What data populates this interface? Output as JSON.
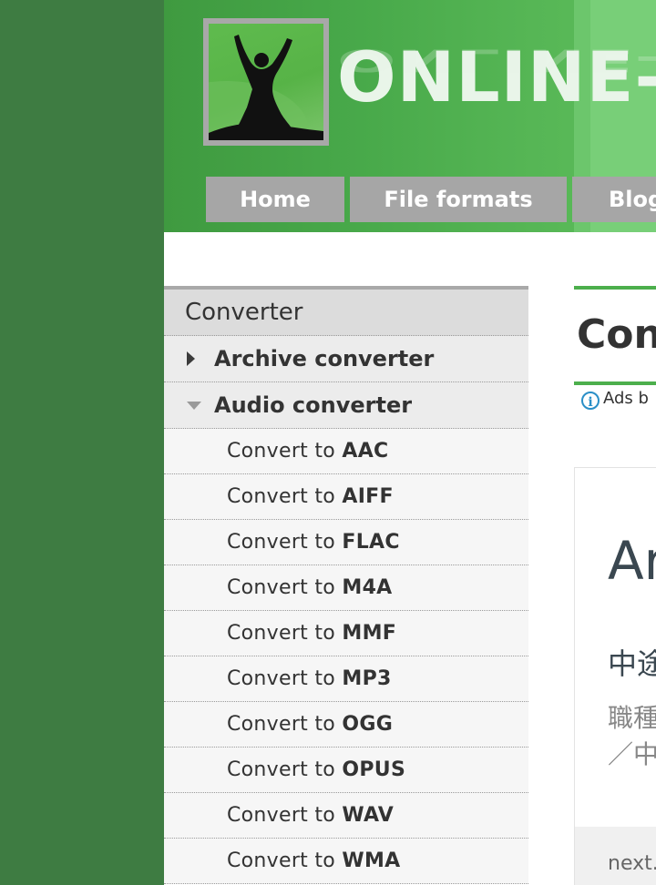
{
  "header": {
    "brand": "ONLINE-",
    "nav": [
      {
        "label": "Home"
      },
      {
        "label": "File formats"
      },
      {
        "label": "Blog"
      }
    ]
  },
  "sidebar": {
    "title": "Converter",
    "categories": [
      {
        "label": "Archive converter",
        "state": "collapsed"
      },
      {
        "label": "Audio converter",
        "state": "expanded"
      }
    ],
    "audio_items": [
      {
        "prefix": "Convert to ",
        "format": "AAC"
      },
      {
        "prefix": "Convert to ",
        "format": "AIFF"
      },
      {
        "prefix": "Convert to ",
        "format": "FLAC"
      },
      {
        "prefix": "Convert to ",
        "format": "M4A"
      },
      {
        "prefix": "Convert to ",
        "format": "MMF"
      },
      {
        "prefix": "Convert to ",
        "format": "MP3"
      },
      {
        "prefix": "Convert to ",
        "format": "OGG"
      },
      {
        "prefix": "Convert to ",
        "format": "OPUS"
      },
      {
        "prefix": "Convert to ",
        "format": "WAV"
      },
      {
        "prefix": "Convert to ",
        "format": "WMA"
      }
    ]
  },
  "main": {
    "title": "Conv",
    "ads_label": "Ads b",
    "ad": {
      "headline": "Ar",
      "line1": "中途",
      "line2a": "職種",
      "line2b": "／中",
      "footer": "next."
    }
  },
  "colors": {
    "page_bg": "#3e7c42",
    "accent_green": "#4caf4c",
    "nav_bg": "#a6a6a6"
  }
}
